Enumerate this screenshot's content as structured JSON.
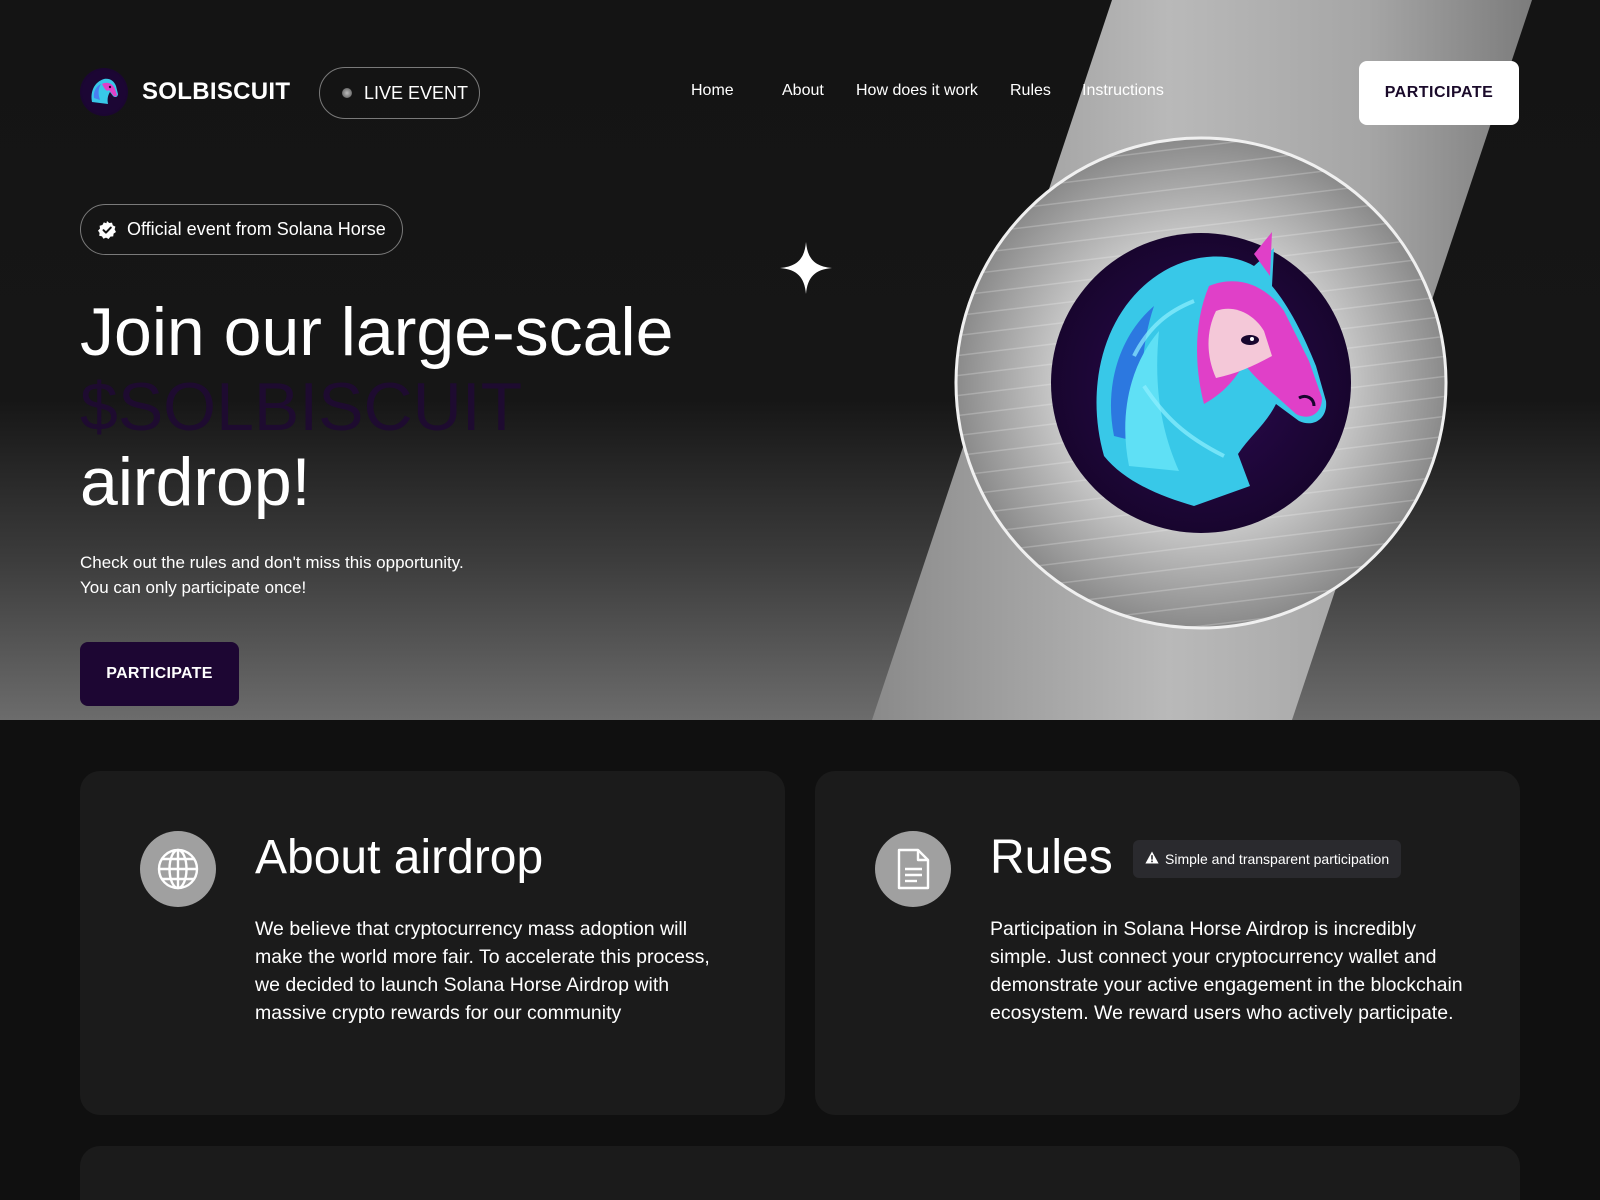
{
  "header": {
    "brand": "SOLBISCUIT",
    "live_label": "LIVE EVENT",
    "nav": [
      "Home",
      "About",
      "How does it work",
      "Rules",
      "Instructions"
    ],
    "participate_label": "PARTICIPATE"
  },
  "hero": {
    "official_label": "Official event from Solana Horse",
    "headline_1": "Join our large-scale",
    "headline_accent": "$SOLBISCUIT",
    "headline_3": "airdrop!",
    "sub_1": "Check out the rules and don't miss this opportunity.",
    "sub_2": "You can only participate once!",
    "participate_label": "PARTICIPATE"
  },
  "about": {
    "title": "About airdrop",
    "body": "We believe that cryptocurrency mass adoption will make the world more fair. To accelerate this process, we decided to launch Solana Horse Airdrop with massive crypto rewards for our community"
  },
  "rules": {
    "title": "Rules",
    "badge": "Simple and transparent participation",
    "body": "Participation in Solana Horse Airdrop is incredibly simple. Just connect your cryptocurrency wallet and demonstrate your active engagement in the blockchain ecosystem. We reward users who actively participate."
  },
  "colors": {
    "background": "#101010",
    "card": "#1b1b1b",
    "accent_purple": "#1d0633",
    "horse_magenta": "#e040c8",
    "horse_cyan": "#38c8e8"
  },
  "icons": [
    "horse-logo-icon",
    "live-dot-icon",
    "verified-check-icon",
    "sparkle-icon",
    "globe-icon",
    "document-icon",
    "warning-icon"
  ]
}
